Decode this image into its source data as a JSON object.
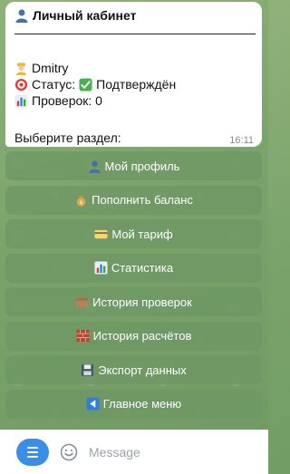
{
  "message": {
    "title": "Личный кабинет",
    "name_line": "Dmitry",
    "status_label": "Статус:",
    "status_value": "Подтверждён",
    "checks_line": "Проверок: 0",
    "prompt": "Выберите раздел:",
    "time": "16:11"
  },
  "keyboard": {
    "buttons": [
      {
        "label": "Мой профиль",
        "icon": "bust-icon"
      },
      {
        "label": "Пополнить баланс",
        "icon": "money-bag-icon"
      },
      {
        "label": "Мой тариф",
        "icon": "credit-card-icon"
      },
      {
        "label": "Статистика",
        "icon": "bar-chart-icon"
      },
      {
        "label": "История проверок",
        "icon": "box-icon"
      },
      {
        "label": "История расчётов",
        "icon": "bricks-icon"
      },
      {
        "label": "Экспорт данных",
        "icon": "floppy-disk-icon"
      },
      {
        "label": "Главное меню",
        "icon": "back-arrow-icon"
      }
    ]
  },
  "input": {
    "placeholder": "Message"
  },
  "colors": {
    "accent": "#3a8ee6",
    "button_bg": "#6e9664",
    "chat_bg": "#7ea56d",
    "status_check": "#4caf50"
  }
}
